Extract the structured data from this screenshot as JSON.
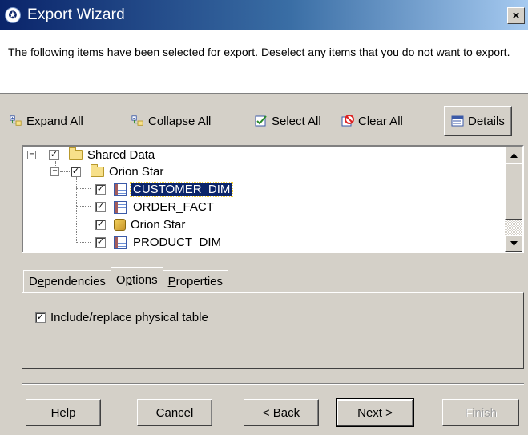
{
  "window": {
    "title": "Export Wizard",
    "close_glyph": "×"
  },
  "description": "The following items have been selected for export.  Deselect any items that you do not want to export.",
  "toolbar": {
    "expand_all": "Expand All",
    "collapse_all": "Collapse All",
    "select_all": "Select All",
    "clear_all": "Clear All",
    "details": "Details"
  },
  "tree": {
    "items": [
      {
        "label": "Shared Data",
        "type": "folder",
        "checked": true,
        "expanded": true
      },
      {
        "label": "Orion Star",
        "type": "folder",
        "checked": true,
        "expanded": true
      },
      {
        "label": "CUSTOMER_DIM",
        "type": "table",
        "checked": true,
        "selected": true
      },
      {
        "label": "ORDER_FACT",
        "type": "table",
        "checked": true
      },
      {
        "label": "Orion Star",
        "type": "cube",
        "checked": true
      },
      {
        "label": "PRODUCT_DIM",
        "type": "table",
        "checked": true
      }
    ]
  },
  "tabs": [
    {
      "prefix": "D",
      "underline": "e",
      "rest": "pendencies"
    },
    {
      "prefix": "O",
      "underline": "p",
      "rest": "tions",
      "active": true
    },
    {
      "prefix": "",
      "underline": "P",
      "rest": "roperties"
    }
  ],
  "options": {
    "include_replace": "Include/replace physical table",
    "checked": true
  },
  "footer": {
    "help": "Help",
    "cancel": "Cancel",
    "back": "< Back",
    "next": "Next >",
    "finish": "Finish"
  },
  "checkmark": "✓"
}
